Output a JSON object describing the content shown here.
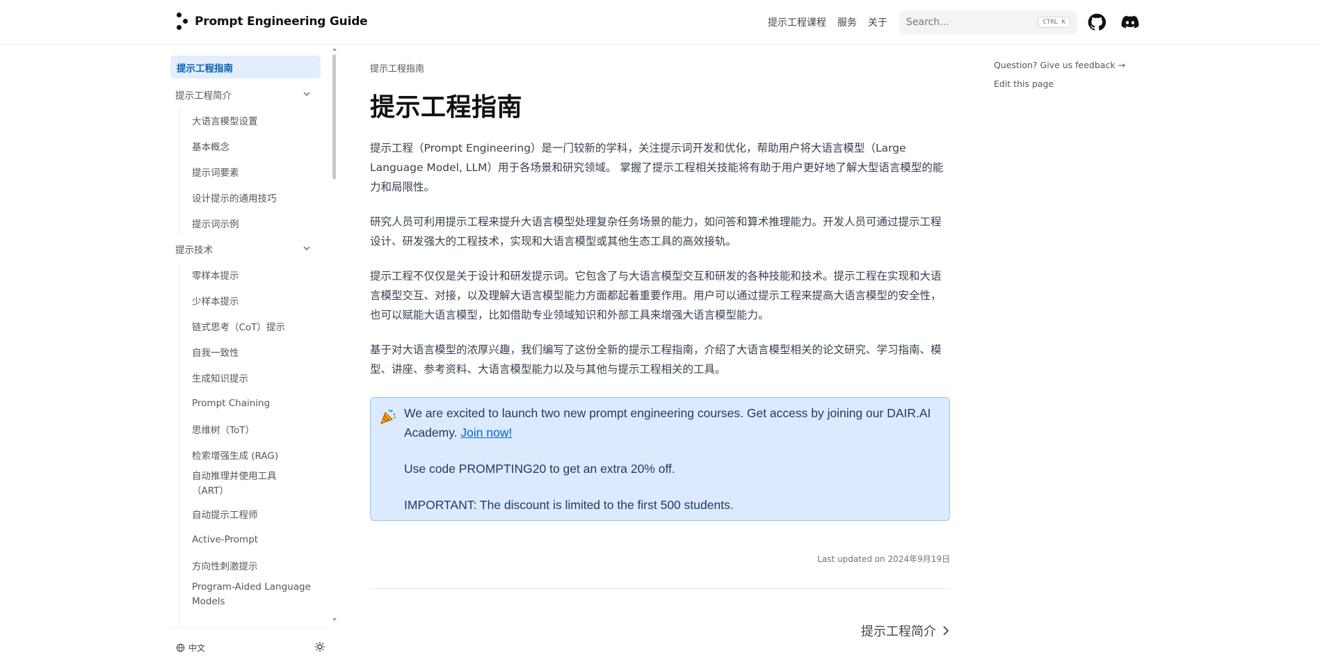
{
  "header": {
    "site_title": "Prompt Engineering Guide",
    "nav": [
      "提示工程课程",
      "服务",
      "关于"
    ],
    "search_placeholder": "Search...",
    "search_kbd": "CTRL K",
    "github_icon": "github-icon",
    "discord_icon": "discord-icon"
  },
  "sidebar": {
    "active": "提示工程指南",
    "sections": [
      {
        "label": "提示工程简介",
        "items": [
          "大语言模型设置",
          "基本概念",
          "提示词要素",
          "设计提示的通用技巧",
          "提示词示例"
        ]
      },
      {
        "label": "提示技术",
        "items": [
          "零样本提示",
          "少样本提示",
          "链式思考（CoT）提示",
          "自我一致性",
          "生成知识提示",
          "Prompt Chaining",
          "思维树（ToT）",
          "检索增强生成 (RAG)",
          "自动推理并使用工具（ART）",
          "自动提示工程师",
          "Active-Prompt",
          "方向性刺激提示",
          "Program-Aided Language Models"
        ]
      }
    ],
    "footer_lang": "中文",
    "theme_icon": "sun-icon"
  },
  "main": {
    "breadcrumb": "提示工程指南",
    "title": "提示工程指南",
    "paragraphs": [
      "提示工程（Prompt Engineering）是一门较新的学科，关注提示词开发和优化，帮助用户将大语言模型（Large Language Model, LLM）用于各场景和研究领域。 掌握了提示工程相关技能将有助于用户更好地了解大型语言模型的能力和局限性。",
      "研究人员可利用提示工程来提升大语言模型处理复杂任务场景的能力，如问答和算术推理能力。开发人员可通过提示工程设计、研发强大的工程技术，实现和大语言模型或其他生态工具的高效接轨。",
      "提示工程不仅仅是关于设计和研发提示词。它包含了与大语言模型交互和研发的各种技能和技术。提示工程在实现和大语言模型交互、对接，以及理解大语言模型能力方面都起着重要作用。用户可以通过提示工程来提高大语言模型的安全性，也可以赋能大语言模型，比如借助专业领域知识和外部工具来增强大语言模型能力。",
      "基于对大语言模型的浓厚兴趣，我们编写了这份全新的提示工程指南，介绍了大语言模型相关的论文研究、学习指南、模型、讲座、参考资料、大语言模型能力以及与其他与提示工程相关的工具。"
    ],
    "callout": {
      "icon": "party-popper-icon",
      "line1_text": "We are excited to launch two new prompt engineering courses. Get access by joining our DAIR.AI Academy.",
      "line1_link": "Join now!",
      "line2": "Use code PROMPTING20 to get an extra 20% off.",
      "line3": "IMPORTANT: The discount is limited to the first 500 students."
    },
    "last_updated": "Last updated on 2024年9月19日",
    "next_page": "提示工程简介"
  },
  "toc": {
    "feedback": "Question? Give us feedback →",
    "edit": "Edit this page"
  }
}
